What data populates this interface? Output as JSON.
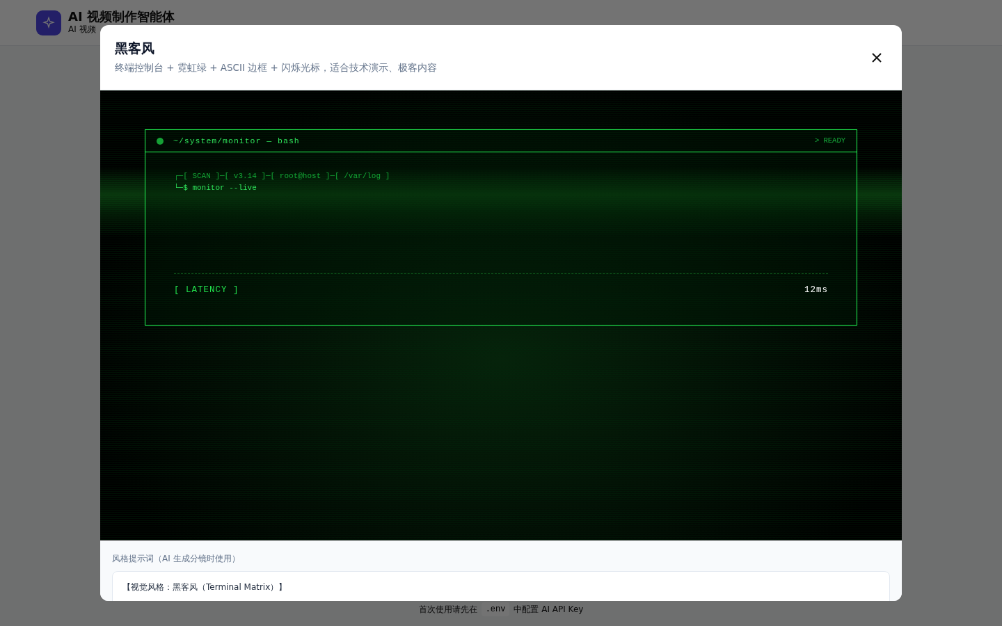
{
  "app": {
    "title": "AI 视频制作智能体",
    "subtitle": "AI 视频"
  },
  "footer_note": {
    "before": "首次使用请先在",
    "code": ".env",
    "after": "中配置 AI API Key"
  },
  "modal": {
    "title": "黑客风",
    "description": "终端控制台 + 霓虹绿 + ASCII 边框 + 闪烁光标，适合技术演示、极客内容",
    "terminal": {
      "title": "~/system/monitor — bash",
      "status": "> READY",
      "prompt_line": "┌─[ SCAN ]─[ v3.14 ]─[ root@host ]─[ /var/log ]",
      "command_line": "└─$ monitor --live",
      "metric_label": "[ LATENCY ]",
      "metric_value": "12ms"
    },
    "prompt_label": "风格提示词（AI 生成分镜时使用）",
    "prompt_text": "【视觉风格：黑客风（Terminal Matrix）】"
  }
}
